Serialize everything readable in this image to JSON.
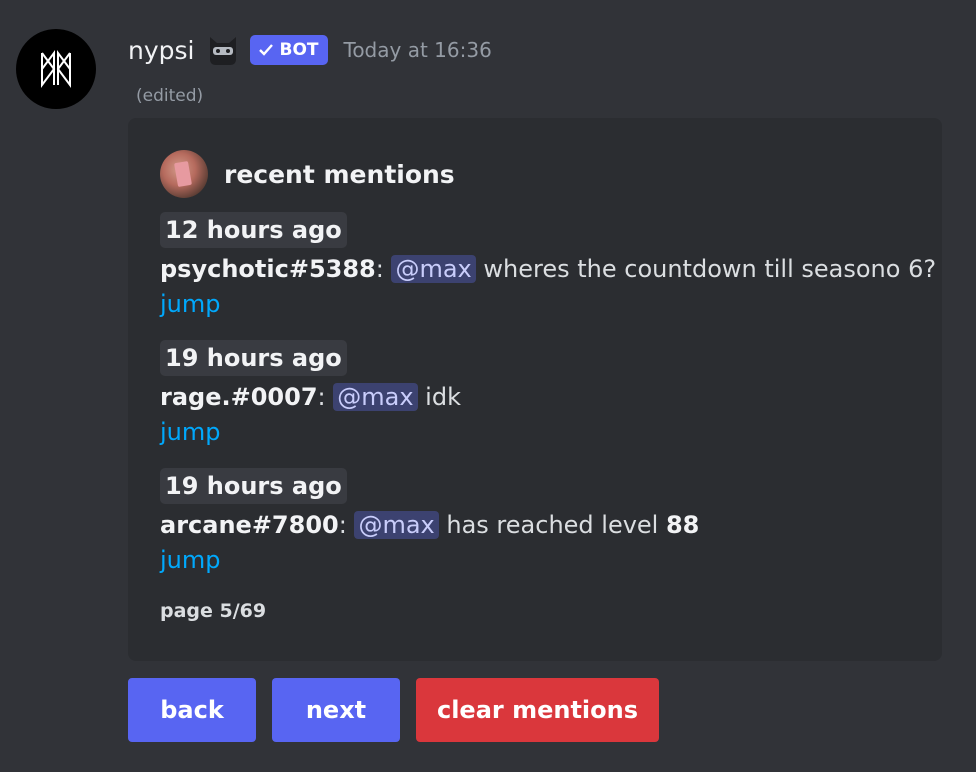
{
  "message": {
    "username": "nypsi",
    "badge": "BOT",
    "timestamp": "Today at 16:36",
    "edited": "(edited)"
  },
  "embed": {
    "title": "recent mentions",
    "mentions": [
      {
        "time": "12 hours ago",
        "author": "psychotic#5388",
        "mention": "@max",
        "text": " wheres the countdown till seasono 6?",
        "jump": "jump"
      },
      {
        "time": "19 hours ago",
        "author": "rage.#0007",
        "mention": "@max",
        "text": " idk",
        "jump": "jump"
      },
      {
        "time": "19 hours ago",
        "author": "arcane#7800",
        "mention": "@max",
        "text": " has reached level ",
        "bold_suffix": "88",
        "jump": "jump"
      }
    ],
    "footer": "page 5/69"
  },
  "buttons": {
    "back": "back",
    "next": "next",
    "clear": "clear mentions"
  },
  "colors": {
    "background": "#313338",
    "embed": "#2b2d31",
    "primary": "#5865f2",
    "danger": "#da373c",
    "link": "#00a8fc",
    "mention_bg": "#3c4270"
  }
}
